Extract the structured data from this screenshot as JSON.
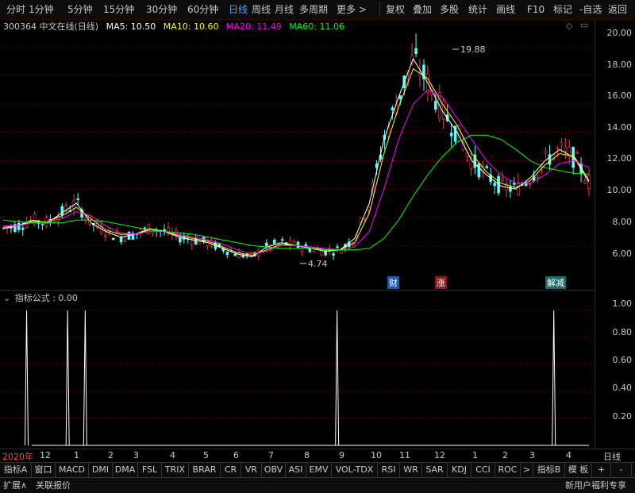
{
  "toolbar": {
    "periods": [
      "分时",
      "1分钟",
      "5分钟",
      "15分钟",
      "30分钟",
      "60分钟",
      "日线",
      "周线",
      "月线",
      "多周期",
      "更多 >"
    ],
    "active_period": "日线",
    "actions": [
      "复权",
      "叠加",
      "多股",
      "统计",
      "画线",
      "F10",
      "标记",
      "-自选",
      "返回"
    ]
  },
  "stock": {
    "code_name": "300364 中文在线(日线)",
    "ma": [
      {
        "label": "MA5: 10.50",
        "color": "#ffffff"
      },
      {
        "label": "MA10: 10.60",
        "color": "#ffff00"
      },
      {
        "label": "MA20: 11.49",
        "color": "#ff00ff"
      },
      {
        "label": "MA60: 11.06",
        "color": "#00ff00"
      }
    ],
    "high_label": "19.88",
    "low_label": "4.74",
    "price_ticks": [
      "20.00",
      "18.00",
      "16.00",
      "14.00",
      "12.00",
      "10.00",
      "8.00",
      "6.00"
    ],
    "tags": [
      {
        "text": "财",
        "color": "#1e5aa8"
      },
      {
        "text": "涨",
        "color": "#8b1a1a"
      },
      {
        "text": "解减",
        "color": "#1e6a6a"
      }
    ]
  },
  "indicator": {
    "title": "指标公式 : 0.00",
    "ticks": [
      "1.00",
      "0.80",
      "0.60",
      "0.40",
      "0.20"
    ]
  },
  "date_axis": {
    "labels": [
      "2020年",
      "12",
      "1",
      "2",
      "3",
      "4",
      "5",
      "6",
      "7",
      "8",
      "9",
      "10",
      "11",
      "12",
      "1",
      "2",
      "3",
      "4"
    ],
    "period_label": "日线"
  },
  "indicator_tabs": [
    "指标A",
    "窗口",
    "MACD",
    "DMI",
    "DMA",
    "FSL",
    "TRIX",
    "BRAR",
    "CR",
    "VR",
    "OBV",
    "ASI",
    "EMV",
    "VOL-TDX",
    "RSI",
    "WR",
    "SAR",
    "KDJ",
    "CCI",
    "ROC",
    ">",
    "指标B",
    "模 板"
  ],
  "statusbar": {
    "left": [
      "扩展∧",
      "关联报价"
    ],
    "right": "新用户福利专享"
  },
  "chart_data": {
    "type": "line",
    "title": "300364 中文在线(日线)",
    "ylim": [
      4.0,
      21.0
    ],
    "series": [
      {
        "name": "MA5",
        "values": [
          7.2,
          7.4,
          7.8,
          7.6,
          8.3,
          9.0,
          7.6,
          7.0,
          6.6,
          6.8,
          7.2,
          7.0,
          6.6,
          6.4,
          6.2,
          5.8,
          5.4,
          5.2,
          5.9,
          6.2,
          6.0,
          5.8,
          5.6,
          5.7,
          6.5,
          9.0,
          13.5,
          16.5,
          19.2,
          17.5,
          15.5,
          14.0,
          12.0,
          11.0,
          10.2,
          10.0,
          10.8,
          12.0,
          12.8,
          12.2,
          10.5
        ]
      },
      {
        "name": "MA10",
        "values": [
          7.3,
          7.4,
          7.7,
          7.7,
          8.1,
          8.7,
          7.9,
          7.1,
          6.8,
          6.8,
          7.1,
          7.0,
          6.7,
          6.5,
          6.3,
          5.9,
          5.5,
          5.3,
          5.7,
          6.1,
          6.0,
          5.9,
          5.7,
          5.7,
          6.2,
          8.3,
          12.5,
          15.8,
          18.5,
          17.8,
          16.0,
          14.5,
          12.5,
          11.2,
          10.4,
          10.1,
          10.6,
          11.7,
          12.5,
          12.3,
          10.6
        ]
      },
      {
        "name": "MA20",
        "values": [
          7.4,
          7.4,
          7.6,
          7.7,
          7.9,
          8.4,
          8.1,
          7.4,
          6.9,
          6.8,
          7.0,
          7.0,
          6.8,
          6.6,
          6.4,
          6.1,
          5.7,
          5.4,
          5.6,
          6.0,
          6.0,
          5.9,
          5.8,
          5.7,
          5.9,
          7.0,
          10.0,
          13.5,
          16.0,
          17.0,
          16.5,
          15.0,
          13.5,
          12.0,
          11.0,
          10.4,
          10.4,
          11.0,
          11.8,
          12.0,
          11.5
        ]
      },
      {
        "name": "MA60",
        "values": [
          7.8,
          7.7,
          7.6,
          7.6,
          7.6,
          7.8,
          7.8,
          7.7,
          7.5,
          7.3,
          7.1,
          7.0,
          6.9,
          6.8,
          6.6,
          6.4,
          6.2,
          6.0,
          5.9,
          5.8,
          5.8,
          5.8,
          5.7,
          5.7,
          5.7,
          5.8,
          6.5,
          7.8,
          9.5,
          11.0,
          12.3,
          13.3,
          13.8,
          13.8,
          13.5,
          12.8,
          12.0,
          11.5,
          11.3,
          11.1,
          11.06
        ]
      }
    ],
    "annotations": [
      {
        "text": "19.88",
        "y": 19.88
      },
      {
        "text": "4.74",
        "y": 4.74
      }
    ],
    "indicator_series": {
      "name": "指标公式",
      "spikes": [
        0.04,
        0.11,
        0.14,
        0.57,
        0.94
      ],
      "value": 1.0,
      "ylim": [
        0,
        1.1
      ]
    }
  }
}
